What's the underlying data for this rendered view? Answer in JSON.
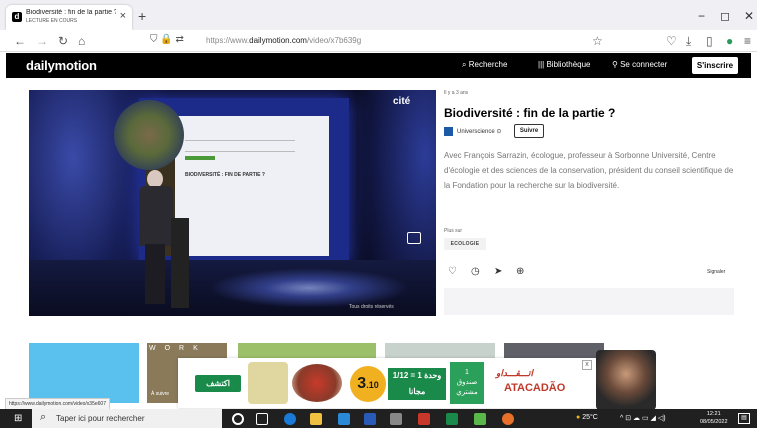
{
  "browser": {
    "tab_title": "Biodiversité : fin de la partie ?",
    "tab_subtitle": "LECTURE EN COURS",
    "new_tab": "+",
    "url_prefix": "https://www.",
    "url_domain": "dailymotion.com",
    "url_path": "/video/x7b639g",
    "min": "−",
    "max": "◻",
    "close": "✕"
  },
  "site": {
    "logo": "dailymotion",
    "search": "Recherche",
    "library": "Bibliothèque",
    "login": "Se connecter",
    "signup": "S'inscrire"
  },
  "video": {
    "overlay_logo": "cité",
    "slide_title": "BIODIVERSITÉ : FIN DE PARTIE ?",
    "rights": "Tous droits réservés"
  },
  "details": {
    "ago": "Il y a 3 ans",
    "title": "Biodiversité : fin de la partie ?",
    "channel": "Universcience",
    "follow": "Suivre",
    "description": "Avec François Sarrazin, écologue, professeur à Sorbonne Université, Centre d'écologie et des sciences de la conservation, président du conseil scientifique de la Fondation pour la recherche sur la biodiversité.",
    "more_on": "Plus sur",
    "tag": "ECOLOGIE",
    "report": "Signaler"
  },
  "reco": {
    "r2_letters": "WORK",
    "r2_caption": "À suivre"
  },
  "ad": {
    "button": "اكتشف",
    "price_big": "3",
    "price_small": ".10",
    "mid_top": "1/12 = 1 وحدة",
    "mid_bottom": "مجانا",
    "green_top": "1",
    "green_mid": "صندوق",
    "green_bottom": "مشتري",
    "brand_ar": "اتـــقـــداو",
    "brand_lat": "ATACADÃO",
    "close": "x"
  },
  "status_url": "https://www.dailymotion.com/video/x35e607",
  "taskbar": {
    "search_placeholder": "Taper ici pour rechercher",
    "weather": "25°C",
    "time": "12:21",
    "date": "08/05/2022"
  }
}
